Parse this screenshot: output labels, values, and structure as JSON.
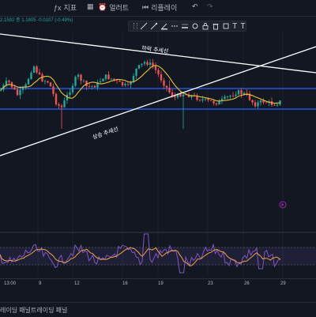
{
  "toolbar": {
    "indicators_label": "지표",
    "alert_label": "얼러트",
    "replay_label": "리플레이",
    "undo_icon": "undo-icon",
    "redo_icon": "redo-icon"
  },
  "ohlc_text": "2.1592  종 1.1805  -0.0107 (-0.49%)",
  "drawing_toolbar": {
    "tools": [
      "pencil-icon",
      "brush-icon",
      "color-icon",
      "line-style-icon",
      "width-icon",
      "settings-icon",
      "lock-icon",
      "trash-icon",
      "more-icon",
      "text-icon",
      "text-icon"
    ]
  },
  "chart": {
    "annotations": {
      "descending_trendline": "하락 추세선",
      "ascending_trendline": "상승 추세선"
    },
    "x_labels": [
      "13:00",
      "9",
      "12",
      "16",
      "19",
      "23",
      "26",
      "29"
    ],
    "colors": {
      "up": "#26a69a",
      "down": "#ef5350",
      "ma": "#e8c23a",
      "level": "#2962ff",
      "oscillator": "#7e57c2",
      "oscillator_signal": "#f0a04b",
      "background": "#131722"
    }
  },
  "bottom_tabs": [
    "레이딩 패널",
    "트레이딩 패널"
  ]
}
